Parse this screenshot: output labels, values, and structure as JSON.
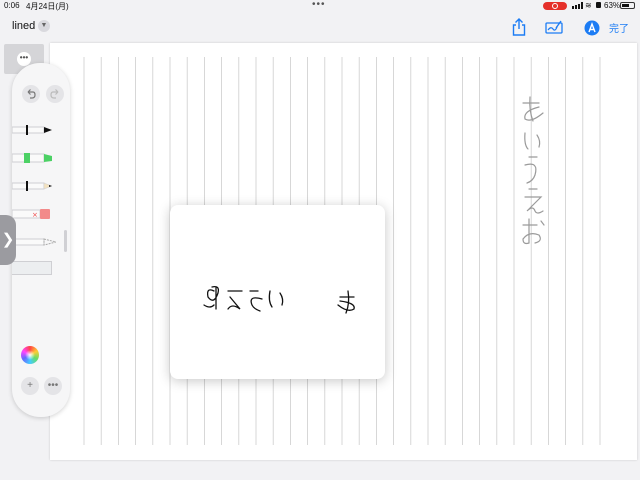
{
  "status_bar": {
    "time": "0:06",
    "date": "4月24日(月)",
    "multitask_dots": "•••",
    "battery_percent": "63%",
    "battery_level": 0.63,
    "recording_color": "#e5302a"
  },
  "toolbar": {
    "document_title": "lined",
    "done_label": "完了",
    "share_icon": "share-icon",
    "markup_icon": "pen-signature-icon",
    "autofill_icon": "autofill-a-icon",
    "accent_color": "#1c7cf4"
  },
  "page": {
    "paper_style": "lined (vertical rules)",
    "handwriting_color": "#999999",
    "ink_color": "#111111"
  },
  "palette": {
    "undo_icon": "undo-arrow-icon",
    "redo_icon": "redo-arrow-icon",
    "more_dots": "•••",
    "tools": [
      "pen",
      "marker",
      "pencil",
      "eraser",
      "lasso",
      "ruler"
    ],
    "colors": [
      "#f7c92e",
      "#000000",
      "#ea3040",
      "#1976f2",
      "multicolor",
      "#4cd165"
    ],
    "add_label": "+",
    "more_label": "•••"
  },
  "sidebar_toggle_label": "❯"
}
